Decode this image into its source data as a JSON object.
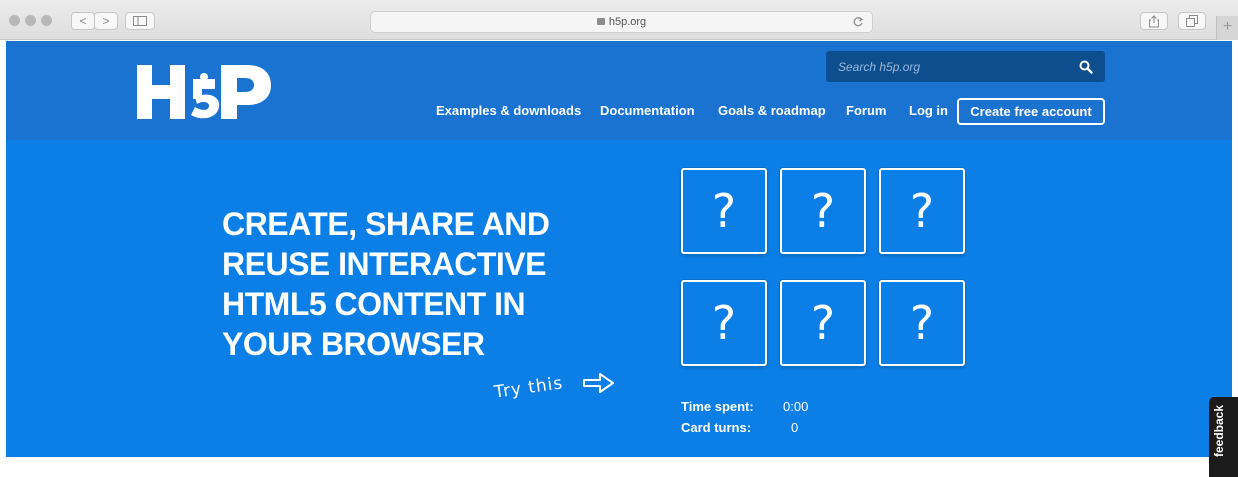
{
  "browser": {
    "url": "h5p.org",
    "back_label": "<",
    "forward_label": ">"
  },
  "site": {
    "logo_text": "H5P",
    "search_placeholder": "Search h5p.org",
    "nav": [
      "Examples & downloads",
      "Documentation",
      "Goals & roadmap",
      "Forum",
      "Log in"
    ],
    "cta_label": "Create free account"
  },
  "hero": {
    "headline_lines": [
      "CREATE, SHARE AND",
      "REUSE INTERACTIVE",
      "HTML5 CONTENT IN",
      "YOUR BROWSER"
    ],
    "try_label": "Try this",
    "cards": [
      "?",
      "?",
      "?",
      "?",
      "?",
      "?"
    ],
    "stats": {
      "time_label": "Time spent:",
      "time_value": "0:00",
      "turns_label": "Card turns:",
      "turns_value": "0"
    }
  },
  "feedback_label": "feedback",
  "colors": {
    "header_blue": "#1a73d0",
    "hero_blue": "#0b7fe6",
    "search_bg": "#0d4e8f"
  }
}
